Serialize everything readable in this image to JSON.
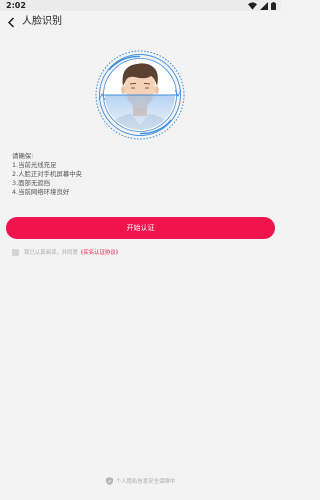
{
  "status_bar": {
    "time": "2:02"
  },
  "header": {
    "title": "人脸识别"
  },
  "instructions": {
    "heading": "请确保:",
    "items": [
      "1.当前光线充足",
      "2.人脸正对手机屏幕中央",
      "3.面部无遮挡",
      "4.当前网络环境良好"
    ]
  },
  "start_button": {
    "label": "开始认证"
  },
  "agreement": {
    "text": "我已认真阅读，并同意",
    "link": "《实名认证协议》"
  },
  "footer": {
    "text": "个人隐私信息安全保障中"
  },
  "colors": {
    "accent": "#f0134d",
    "scan_blue": "#3f8fe0"
  }
}
